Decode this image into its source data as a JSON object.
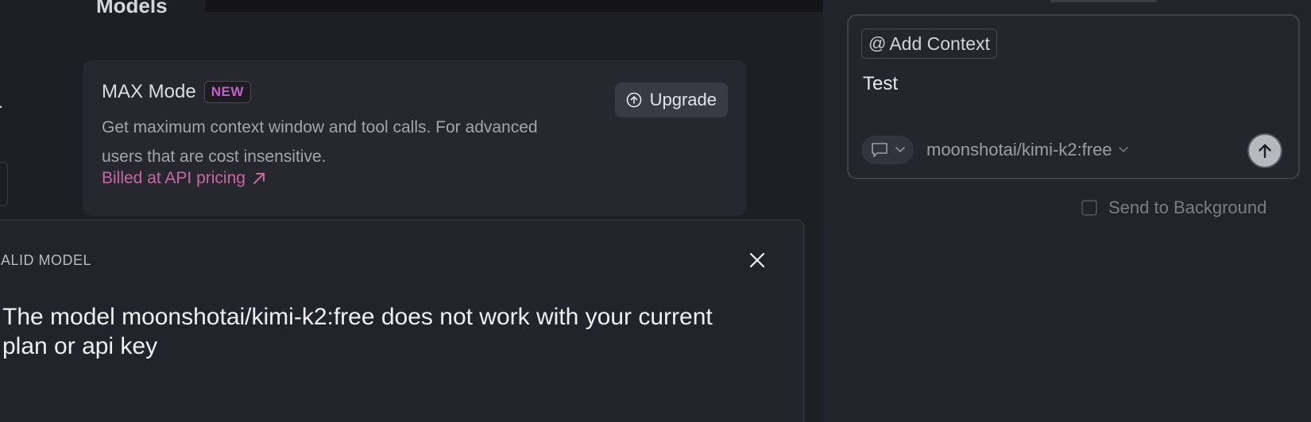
{
  "settings": {
    "section_heading": "Models",
    "max_mode": {
      "title": "MAX Mode",
      "badge": "NEW",
      "description": "Get maximum context window and tool calls. For advanced users that are cost insensitive.",
      "link_label": "Billed at API pricing",
      "upgrade_label": "Upgrade"
    }
  },
  "error_dialog": {
    "heading": "ALID MODEL",
    "message": "The model moonshotai/kimi-k2:free does not work with your current plan or api key"
  },
  "chat": {
    "add_context_label": "Add Context",
    "input_text": "Test",
    "model_name": "moonshotai/kimi-k2:free",
    "send_to_background_label": "Send to Background"
  },
  "icons": {
    "at": "at-icon",
    "upgrade": "arrow-up-circle-icon",
    "external_link": "arrow-up-right-icon",
    "close": "close-icon",
    "chat_mode": "chat-bubble-icon",
    "chevron": "chevron-down-icon",
    "send": "arrow-up-icon"
  },
  "colors": {
    "accent_pink": "#c36aa3",
    "badge_purple": "#c162c9",
    "background": "#1e1e25"
  }
}
